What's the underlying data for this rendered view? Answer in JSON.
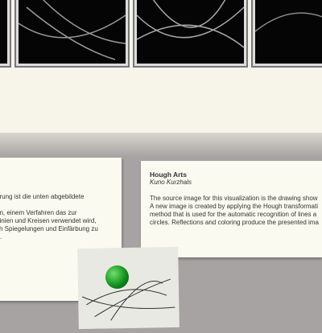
{
  "left_card": {
    "lines": [
      "erung ist die unten abgebildete",
      "",
      "on, einem Verfahren das zur",
      "Linien und Kreisen verwendet wird,",
      "ch Spiegelungen und Einfärbung zu",
      "rt."
    ]
  },
  "right_card": {
    "title": "Hough Arts",
    "author": "Kuno Kurzhals",
    "lines": [
      "The source image for this visualization is the drawing show",
      "A new image is created by applying the Hough transformati",
      "method that is used for the automatic recognition of lines a",
      "circles. Reflections and coloring produce the presented ima"
    ]
  },
  "colors": {
    "wall": "#f7f5ea",
    "floor": "#a7a3a3",
    "ball": "#1aa82a"
  }
}
